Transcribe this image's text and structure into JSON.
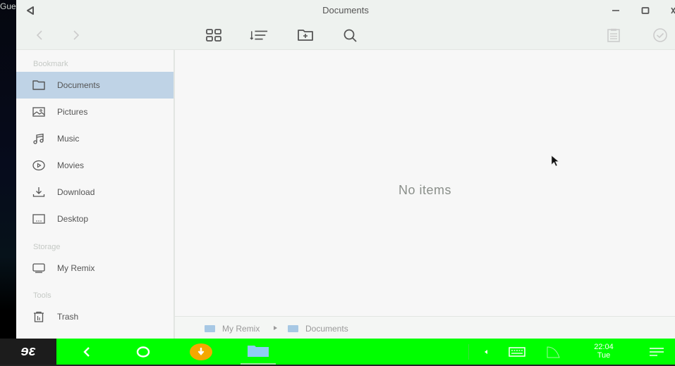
{
  "desktop": {
    "guest_label": "Guest"
  },
  "window": {
    "title": "Documents",
    "controls": {
      "minimize": "minimize-icon",
      "maximize": "maximize-icon",
      "close": "close-icon"
    }
  },
  "toolbar": {
    "back": "chevron-left-icon",
    "forward": "chevron-right-icon",
    "view": "grid-view-icon",
    "sort": "sort-icon",
    "new_folder": "new-folder-icon",
    "search": "search-icon",
    "properties": "clipboard-icon",
    "select": "check-circle-icon"
  },
  "sidebar": {
    "sections": [
      {
        "label": "Bookmark"
      },
      {
        "label": "Storage"
      },
      {
        "label": "Tools"
      }
    ],
    "items": [
      {
        "label": "Documents",
        "icon": "folder-icon",
        "active": true
      },
      {
        "label": "Pictures",
        "icon": "image-icon",
        "active": false
      },
      {
        "label": "Music",
        "icon": "music-icon",
        "active": false
      },
      {
        "label": "Movies",
        "icon": "play-circle-icon",
        "active": false
      },
      {
        "label": "Download",
        "icon": "download-icon",
        "active": false
      },
      {
        "label": "Desktop",
        "icon": "desktop-icon",
        "active": false
      },
      {
        "label": "My Remix",
        "icon": "monitor-icon",
        "active": false
      },
      {
        "label": "Trash",
        "icon": "trash-icon",
        "active": false
      }
    ]
  },
  "content": {
    "empty_message": "No items"
  },
  "pathbar": {
    "crumbs": [
      "My Remix",
      "Documents"
    ]
  },
  "taskbar": {
    "launcher_label": "ɘɛ",
    "clock": {
      "time": "22:04",
      "day": "Tue"
    },
    "colors": {
      "bar": "#00ff00",
      "download_badge": "#f5a800",
      "file_app": "#8fcdf5"
    }
  }
}
